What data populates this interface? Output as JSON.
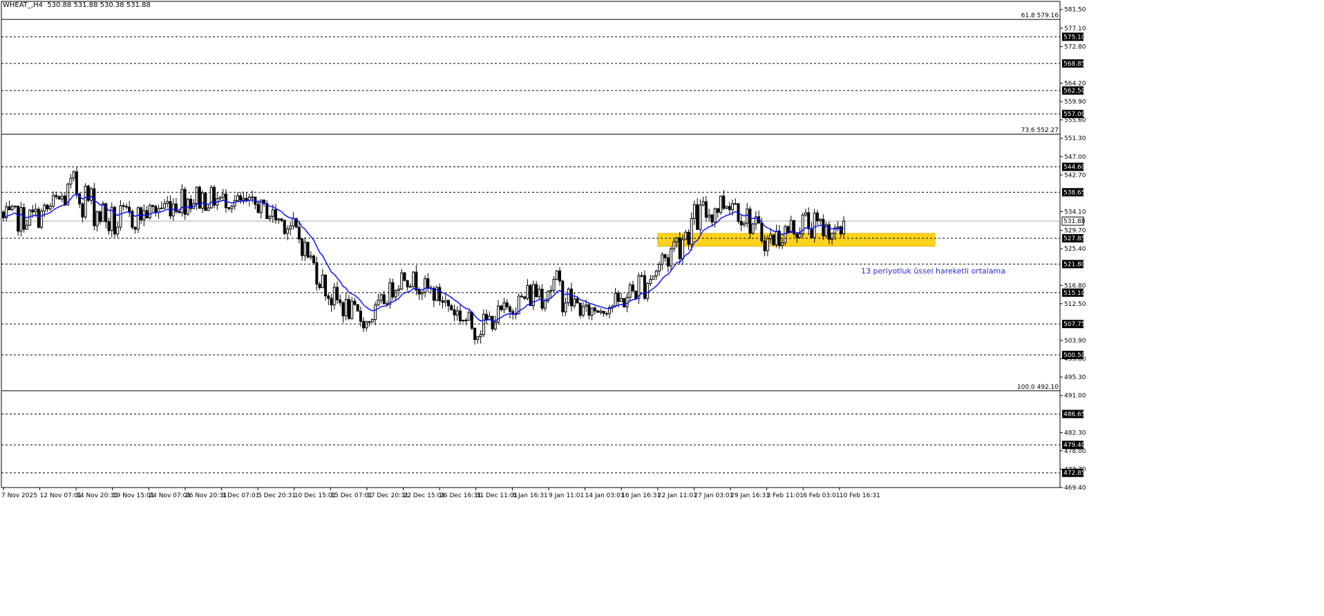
{
  "header": {
    "symbol": "WHEAT_",
    "timeframe": "H4",
    "ohlc_text": "530.88 531.88 530.38 531.88"
  },
  "annotation": "13 periyotluk üssel hareketli ortalama",
  "colors": {
    "background": "#ffffff",
    "candle": "#000000",
    "ema": "#0a14ff",
    "zone": "#ffd21e",
    "zone_border": "#e6b400",
    "fib_line": "#000000",
    "level_line": "#000000",
    "annotation": "#2b2bd6"
  },
  "chart_data": {
    "type": "candlestick",
    "symbol": "WHEAT_",
    "timeframe": "H4",
    "ylim": [
      469.4,
      583.4
    ],
    "y_ticks": [
      "581.50",
      "577.10",
      "572.80",
      "564.20",
      "559.90",
      "555.60",
      "551.30",
      "547.00",
      "542.70",
      "534.10",
      "529.70",
      "525.40",
      "516.80",
      "512.50",
      "503.90",
      "499.60",
      "495.30",
      "491.00",
      "482.30",
      "478.00",
      "473.70",
      "469.40"
    ],
    "x_tick_labels": [
      "7 Nov 2025",
      "12 Nov 07:01",
      "14 Nov 20:31",
      "19 Nov 15:01",
      "24 Nov 07:01",
      "26 Nov 20:31",
      "3 Dec 07:01",
      "5 Dec 20:31",
      "10 Dec 15:01",
      "15 Dec 07:01",
      "17 Dec 20:31",
      "22 Dec 15:01",
      "26 Dec 16:31",
      "31 Dec 11:01",
      "6 Jan 16:31",
      "9 Jan 11:01",
      "14 Jan 03:01",
      "16 Jan 16:31",
      "22 Jan 11:01",
      "27 Jan 03:01",
      "29 Jan 16:31",
      "3 Feb 11:01",
      "6 Feb 03:01",
      "10 Feb 16:31"
    ],
    "horizontal_levels": [
      575.1,
      568.85,
      562.5,
      557.0,
      544.6,
      538.65,
      527.85,
      521.8,
      515.1,
      507.75,
      500.5,
      486.65,
      479.4,
      472.85
    ],
    "current_price": 531.88,
    "fibonacci": [
      {
        "label": "61.8 579.16",
        "value": 579.16
      },
      {
        "label": "73.6 552.27",
        "value": 552.27
      },
      {
        "label": "100.0 492.10",
        "value": 492.1
      }
    ],
    "highlight_zone": {
      "low": 526.0,
      "high": 529.0,
      "x_start": "22 Jan 11:01",
      "x_end": "10 Feb 16:31"
    },
    "ema_period": 13,
    "price_path": [
      [
        "7 Nov 2025",
        538,
        526,
        534
      ],
      [
        "12 Nov 07:01",
        538,
        528,
        532
      ],
      [
        "14 Nov 20:31",
        549,
        530,
        546
      ],
      [
        "19 Nov 15:01",
        540,
        522,
        532
      ],
      [
        "24 Nov 07:01",
        538,
        530,
        536
      ],
      [
        "26 Nov 20:31",
        545,
        530,
        536
      ],
      [
        "3 Dec 07:01",
        541,
        533,
        538
      ],
      [
        "5 Dec 20:31",
        539,
        532,
        534
      ],
      [
        "10 Dec 15:01",
        535,
        525,
        530
      ],
      [
        "15 Dec 07:01",
        520,
        508,
        512
      ],
      [
        "17 Dec 20:31",
        512,
        504,
        508
      ],
      [
        "22 Dec 15:01",
        524,
        515,
        520
      ],
      [
        "26 Dec 16:31",
        518,
        510,
        512
      ],
      [
        "31 Dec 11:01",
        512,
        501,
        508
      ],
      [
        "6 Jan 16:31",
        516,
        508,
        514
      ],
      [
        "9 Jan 11:01",
        528,
        507,
        512
      ],
      [
        "14 Jan 03:01",
        514,
        507,
        511
      ],
      [
        "16 Jan 16:31",
        518,
        508,
        512
      ],
      [
        "22 Jan 11:01",
        532,
        510,
        526
      ],
      [
        "27 Jan 03:01",
        540,
        524,
        537
      ],
      [
        "29 Jan 16:31",
        545,
        530,
        536
      ],
      [
        "3 Feb 11:01",
        532,
        522,
        526
      ],
      [
        "6 Feb 03:01",
        539,
        524,
        528
      ],
      [
        "10 Feb 16:31",
        532,
        526,
        531.88
      ]
    ]
  }
}
